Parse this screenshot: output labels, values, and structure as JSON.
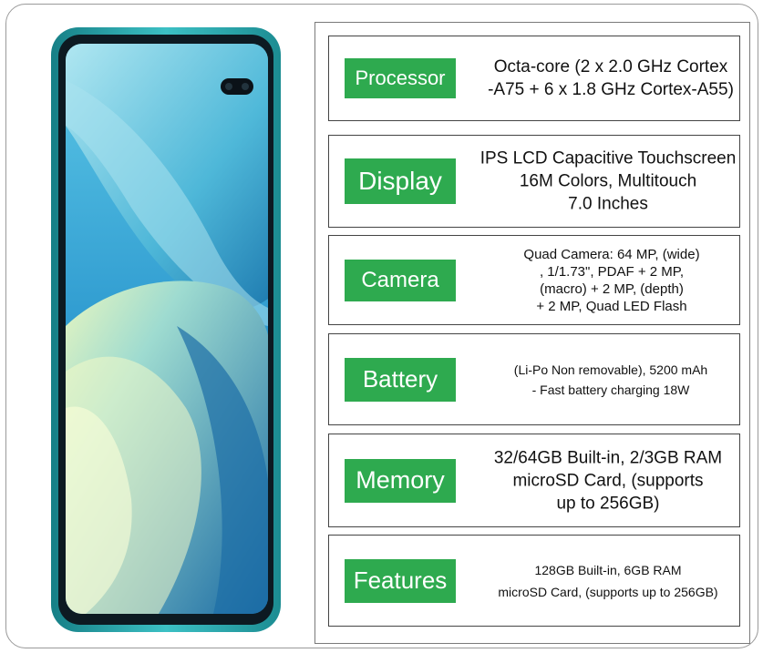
{
  "specs": [
    {
      "label": "Processor",
      "lines": [
        "Octa-core (2 x 2.0 GHz Cortex",
        "-A75 + 6 x 1.8 GHz Cortex-A55)"
      ]
    },
    {
      "label": "Display",
      "lines": [
        "IPS LCD Capacitive Touchscreen",
        "16M Colors, Multitouch",
        "7.0 Inches"
      ]
    },
    {
      "label": "Camera",
      "lines": [
        "Quad Camera: 64 MP, (wide)",
        ", 1/1.73\", PDAF + 2 MP,",
        "(macro) + 2 MP, (depth)",
        "+ 2 MP, Quad LED Flash"
      ]
    },
    {
      "label": "Battery",
      "lines": [
        "(Li-Po Non removable), 5200 mAh",
        "- Fast battery charging 18W"
      ]
    },
    {
      "label": "Memory",
      "lines": [
        "32/64GB Built-in, 2/3GB RAM",
        "microSD Card, (supports",
        "up to 256GB)"
      ]
    },
    {
      "label": "Features",
      "lines": [
        "128GB Built-in, 6GB RAM",
        "microSD Card, (supports up to 256GB)"
      ]
    }
  ],
  "colors": {
    "label_bg": "#2eaa4f",
    "label_text": "#ffffff",
    "phone_frame": "#2fa9b1"
  }
}
